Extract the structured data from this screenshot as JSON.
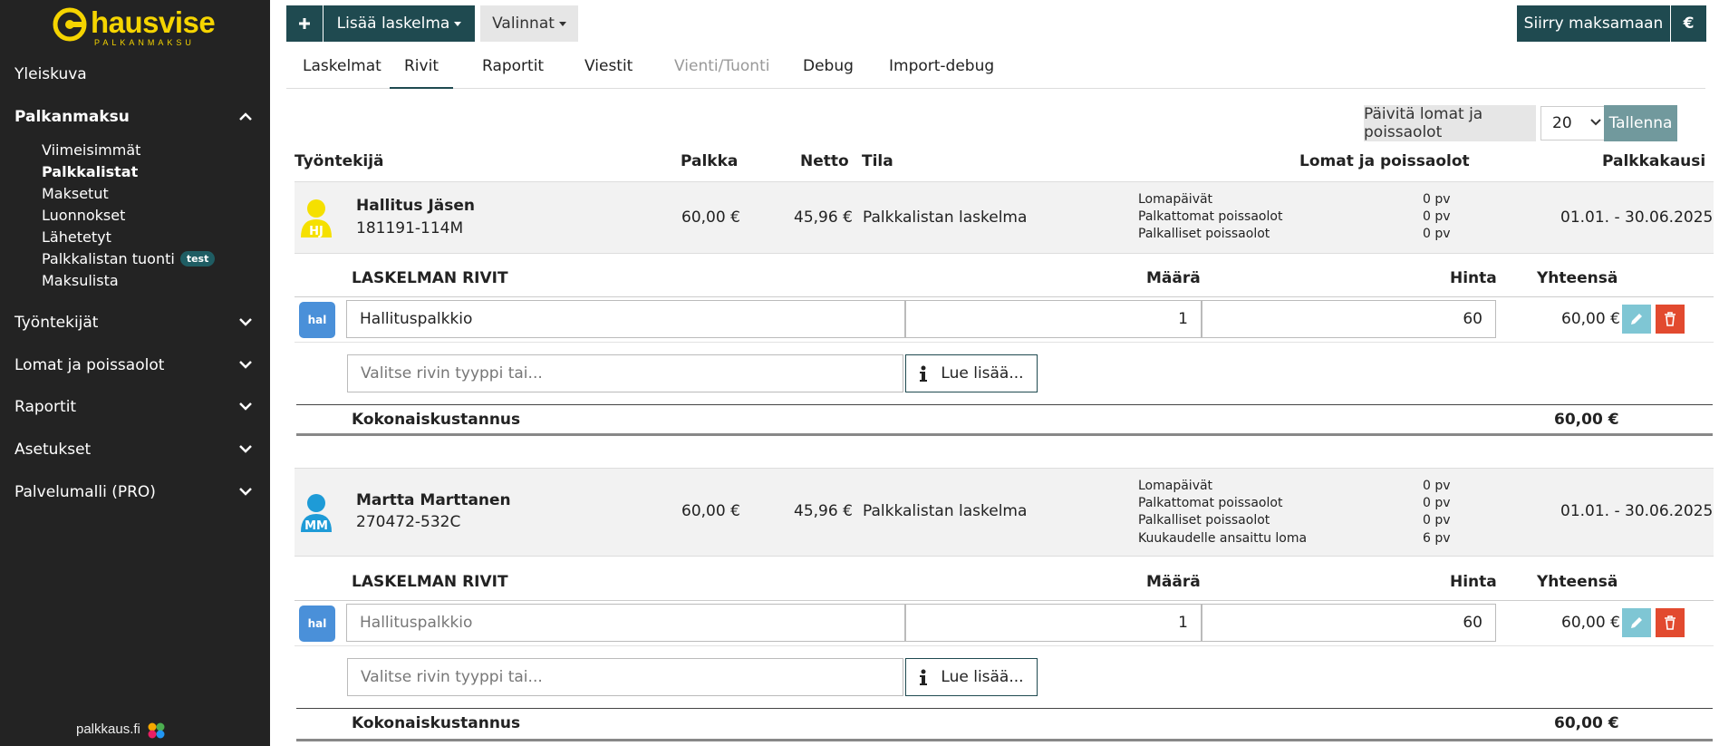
{
  "brand": {
    "name": "hausvise",
    "sub": "PALKANMAKSU",
    "footer": "palkkaus.fi",
    "color": "#f5d400"
  },
  "sidebar": {
    "overview": "Yleiskuva",
    "payroll": "Palkanmaksu",
    "payroll_items": [
      "Viimeisimmät",
      "Palkkalistat",
      "Maksetut",
      "Luonnokset",
      "Lähetetyt",
      "Palkkalistan tuonti",
      "Maksulista"
    ],
    "test_badge": "test",
    "employees": "Työntekijät",
    "holidays": "Lomat ja poissaolot",
    "reports": "Raportit",
    "settings": "Asetukset",
    "service": "Palvelumalli (PRO)"
  },
  "toolbar": {
    "add_label": "Lisää laskelma",
    "options_label": "Valinnat",
    "pay_label": "Siirry maksamaan",
    "currency": "€"
  },
  "tabs": [
    "Laskelmat",
    "Rivit",
    "Raportit",
    "Viestit",
    "Vienti/Tuonti",
    "Debug",
    "Import-debug"
  ],
  "actions": {
    "update_label": "Päivitä lomat ja poissaolot",
    "page_size": "20",
    "save_label": "Tallenna"
  },
  "columns": {
    "employee": "Työntekijä",
    "salary": "Palkka",
    "net": "Netto",
    "status": "Tila",
    "absences": "Lomat ja poissaolot",
    "period": "Palkkakausi"
  },
  "rows_header": {
    "title": "LASKELMAN RIVIT",
    "qty": "Määrä",
    "price": "Hinta",
    "total": "Yhteensä"
  },
  "type_placeholder": "Valitse rivin tyyppi tai...",
  "read_more": "Lue lisää...",
  "total_cost_label": "Kokonaiskustannus",
  "employees": [
    {
      "name": "Hallitus Jäsen",
      "ssn": "181191-114M",
      "initials": "HJ",
      "avatar_color": "#f5e000",
      "salary": "60,00 €",
      "net": "45,96 €",
      "status": "Palkkalistan laskelma",
      "absences": [
        {
          "label": "Lomapäivät",
          "value": "0 pv"
        },
        {
          "label": "Palkattomat poissaolot",
          "value": "0 pv"
        },
        {
          "label": "Palkalliset poissaolot",
          "value": "0 pv"
        }
      ],
      "period": "01.01. - 30.06.2025",
      "line": {
        "badge": "hal",
        "name": "Hallituspalkkio",
        "qty": "1",
        "price": "60",
        "total": "60,00 €"
      },
      "total_cost": "60,00 €"
    },
    {
      "name": "Martta Marttanen",
      "ssn": "270472-532C",
      "initials": "MM",
      "avatar_color": "#1e9bd7",
      "salary": "60,00 €",
      "net": "45,96 €",
      "status": "Palkkalistan laskelma",
      "absences": [
        {
          "label": "Lomapäivät",
          "value": "0 pv"
        },
        {
          "label": "Palkattomat poissaolot",
          "value": "0 pv"
        },
        {
          "label": "Palkalliset poissaolot",
          "value": "0 pv"
        },
        {
          "label": "Kuukaudelle ansaittu loma",
          "value": "6 pv"
        }
      ],
      "period": "01.01. - 30.06.2025",
      "line": {
        "badge": "hal",
        "name": "Hallituspalkkio",
        "qty": "1",
        "price": "60",
        "total": "60,00 €"
      },
      "total_cost": "60,00 €"
    }
  ]
}
